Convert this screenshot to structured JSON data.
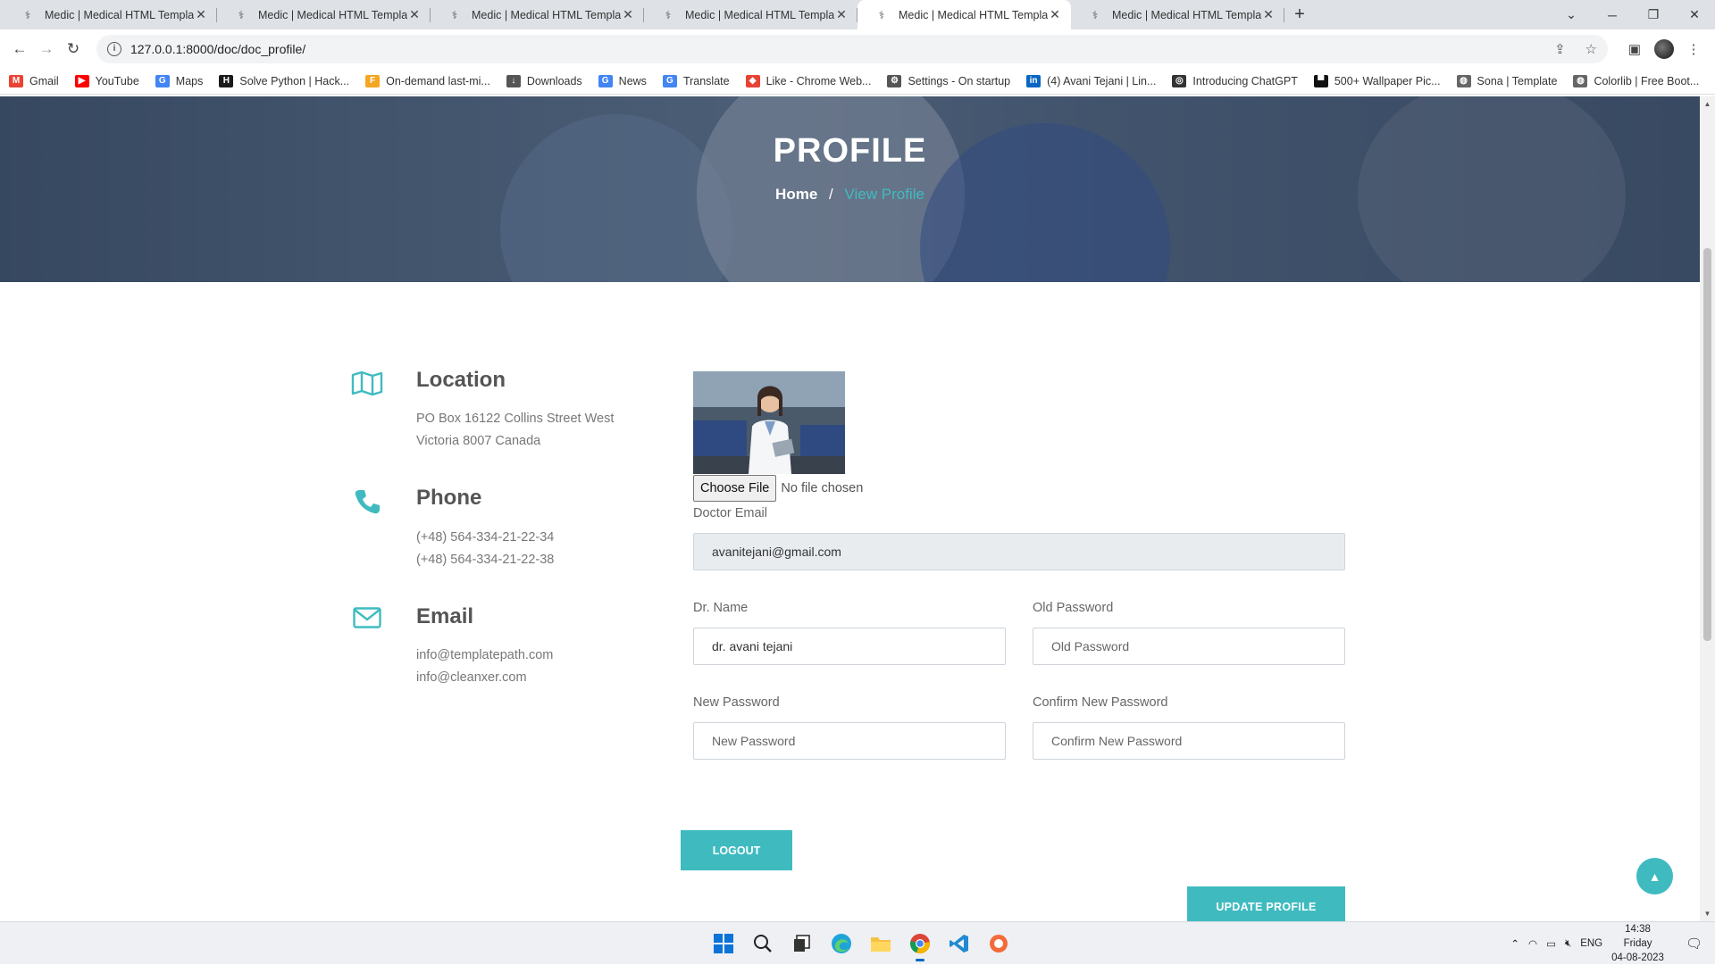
{
  "browser": {
    "tabs": [
      {
        "title": "Medic | Medical HTML Template",
        "active": false
      },
      {
        "title": "Medic | Medical HTML Template",
        "active": false
      },
      {
        "title": "Medic | Medical HTML Template",
        "active": false
      },
      {
        "title": "Medic | Medical HTML Template",
        "active": false
      },
      {
        "title": "Medic | Medical HTML Template",
        "active": true
      },
      {
        "title": "Medic | Medical HTML Template",
        "active": false
      }
    ],
    "url": "127.0.0.1:8000/doc/doc_profile/",
    "bookmarks": [
      {
        "label": "Gmail",
        "icon": "gmail-icon",
        "color": "#ea4335",
        "glyph": "M"
      },
      {
        "label": "YouTube",
        "icon": "youtube-icon",
        "color": "#ff0000",
        "glyph": "▶"
      },
      {
        "label": "Maps",
        "icon": "google-icon",
        "color": "#4285f4",
        "glyph": "G"
      },
      {
        "label": "Solve Python | Hack...",
        "icon": "hackerrank-icon",
        "color": "#1a1a1a",
        "glyph": "H"
      },
      {
        "label": "On-demand last-mi...",
        "icon": "f-icon",
        "color": "#f5a623",
        "glyph": "F"
      },
      {
        "label": "Downloads",
        "icon": "download-icon",
        "color": "#555555",
        "glyph": "↓"
      },
      {
        "label": "News",
        "icon": "news-icon",
        "color": "#4285f4",
        "glyph": "G"
      },
      {
        "label": "Translate",
        "icon": "translate-icon",
        "color": "#4285f4",
        "glyph": "G"
      },
      {
        "label": "Like - Chrome Web...",
        "icon": "chrome-store-icon",
        "color": "#e94235",
        "glyph": "◆"
      },
      {
        "label": "Settings - On startup",
        "icon": "gear-icon",
        "color": "#555555",
        "glyph": "⚙"
      },
      {
        "label": "(4) Avani Tejani | Lin...",
        "icon": "linkedin-icon",
        "color": "#0a66c2",
        "glyph": "in"
      },
      {
        "label": "Introducing ChatGPT",
        "icon": "chatgpt-icon",
        "color": "#333333",
        "glyph": "◎"
      },
      {
        "label": "500+ Wallpaper Pic...",
        "icon": "wallpaper-icon",
        "color": "#111111",
        "glyph": "▀"
      },
      {
        "label": "Sona | Template",
        "icon": "globe-icon",
        "color": "#666666",
        "glyph": "◍"
      },
      {
        "label": "Colorlib | Free Boot...",
        "icon": "globe-icon",
        "color": "#666666",
        "glyph": "◍"
      }
    ]
  },
  "hero": {
    "title": "PROFILE",
    "breadcrumb": {
      "home": "Home",
      "separator": "/",
      "current": "View Profile"
    }
  },
  "contact": [
    {
      "icon": "map-icon",
      "heading": "Location",
      "lines": [
        "PO Box 16122 Collins Street West",
        "Victoria 8007 Canada"
      ]
    },
    {
      "icon": "phone-icon",
      "heading": "Phone",
      "lines": [
        "(+48) 564-334-21-22-34",
        "(+48) 564-334-21-22-38"
      ]
    },
    {
      "icon": "envelope-icon",
      "heading": "Email",
      "lines": [
        "info@templatepath.com",
        "info@cleanxer.com"
      ]
    }
  ],
  "form": {
    "file_button": "Choose File",
    "file_status": "No file chosen",
    "email_label": "Doctor Email",
    "email_value": "avanitejani@gmail.com",
    "name_label": "Dr. Name",
    "name_value": "dr. avani tejani",
    "old_password_label": "Old Password",
    "old_password_placeholder": "Old Password",
    "new_password_label": "New Password",
    "new_password_placeholder": "New Password",
    "confirm_password_label": "Confirm New Password",
    "confirm_password_placeholder": "Confirm New Password",
    "update_button": "UPDATE PROFILE",
    "logout_button": "LOGOUT"
  },
  "taskbar": {
    "language": "ENG",
    "time": "14:38",
    "day": "Friday",
    "date": "04-08-2023"
  },
  "colors": {
    "accent": "#3fbbc0"
  }
}
